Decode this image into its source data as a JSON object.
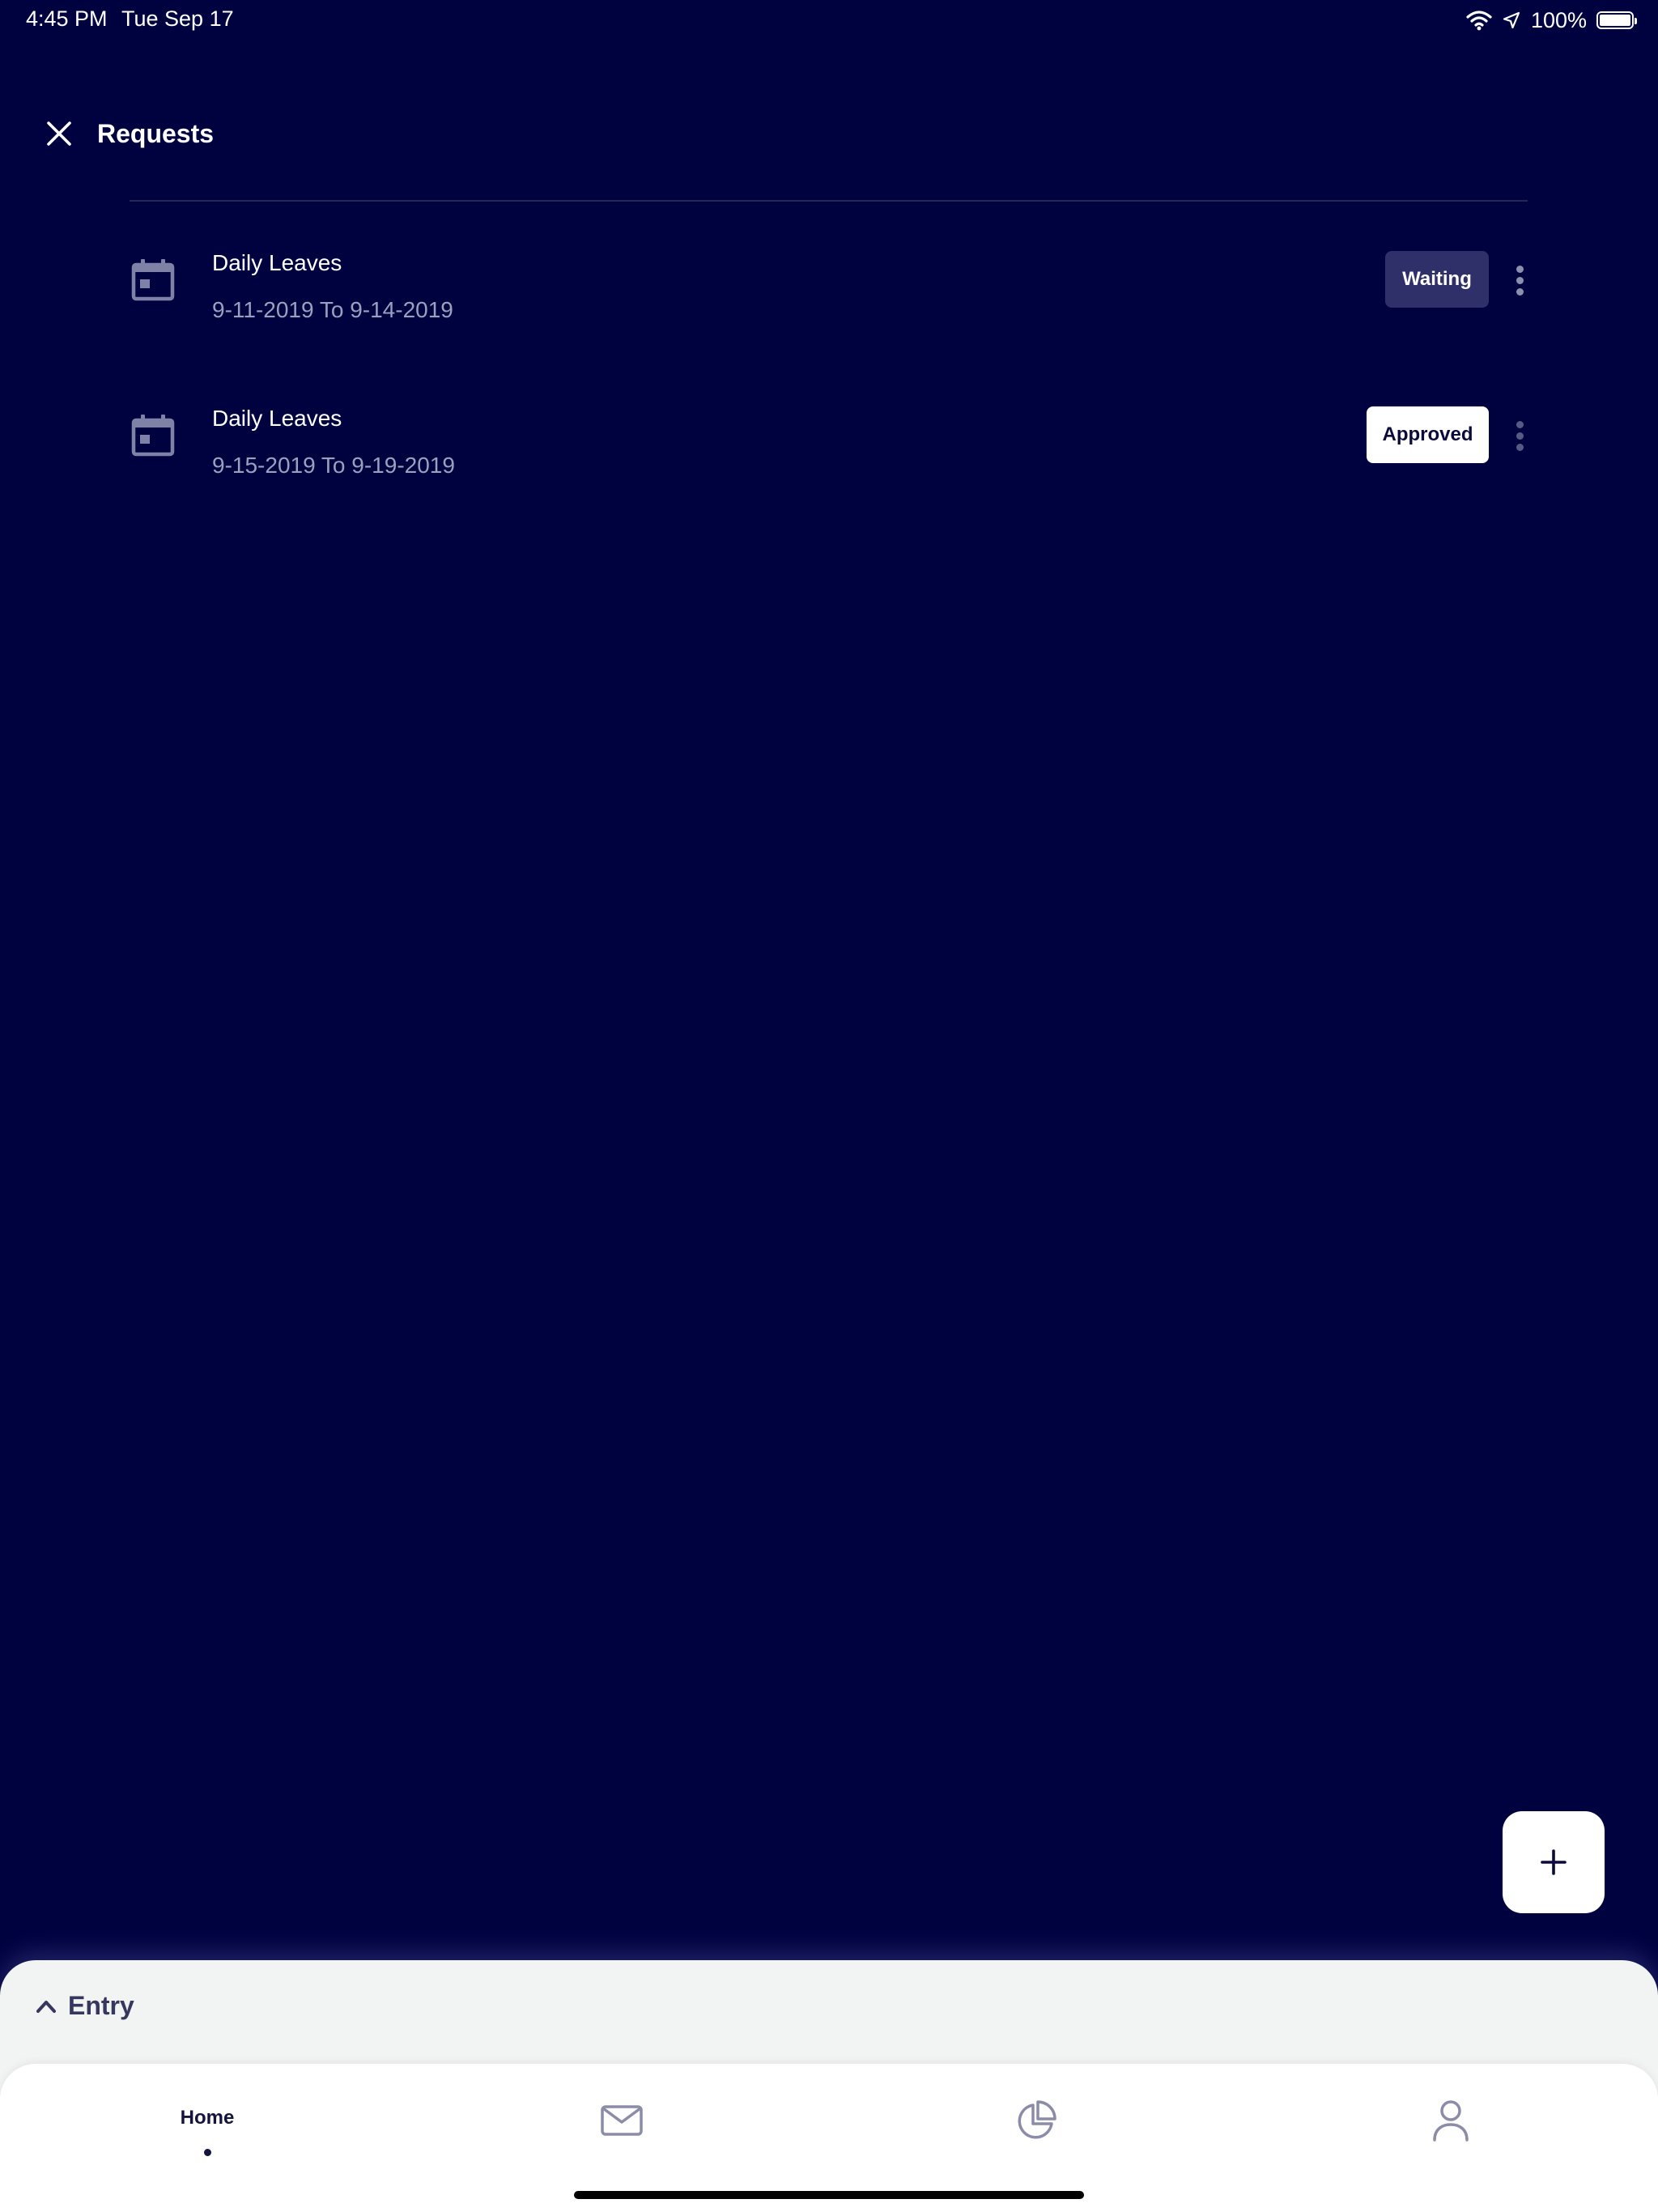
{
  "status_bar": {
    "time": "4:45 PM",
    "date": "Tue Sep 17",
    "battery": "100%",
    "icons": [
      "wifi-icon",
      "location-arrow-icon",
      "battery-icon"
    ]
  },
  "header": {
    "title": "Requests",
    "close_icon": "close-icon"
  },
  "requests": [
    {
      "title": "Daily Leaves",
      "dates": "9-11-2019 To 9-14-2019",
      "status": "Waiting",
      "icon": "calendar-icon"
    },
    {
      "title": "Daily Leaves",
      "dates": "9-15-2019 To 9-19-2019",
      "status": "Approved",
      "icon": "calendar-icon"
    }
  ],
  "fab": {
    "icon": "plus-icon"
  },
  "entry_sheet": {
    "label": "Entry",
    "icon": "chevron-up-icon"
  },
  "tab_bar": {
    "tabs": [
      {
        "label": "Home",
        "active": true
      },
      {
        "icon": "mail-icon"
      },
      {
        "icon": "pie-chart-icon"
      },
      {
        "icon": "user-icon"
      }
    ]
  },
  "colors": {
    "background": "#000240",
    "waiting_badge": "#2f2f69",
    "approved_badge": "#ffffff",
    "sheet": "#f2f3f3",
    "muted_text": "#9d9fbe"
  }
}
